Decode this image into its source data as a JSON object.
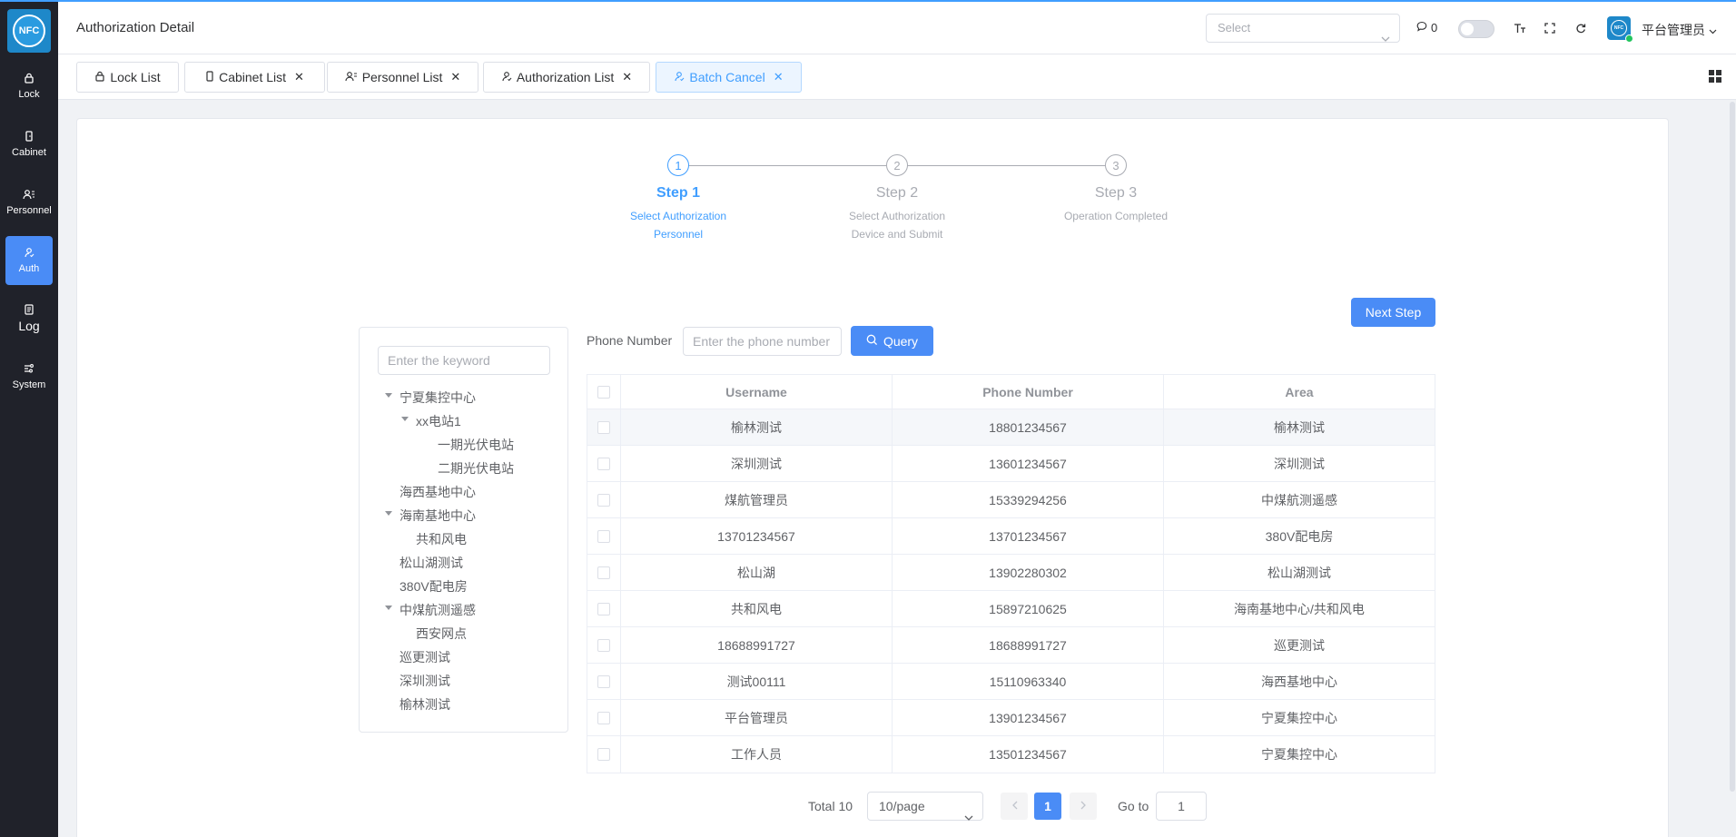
{
  "app": {
    "logo_text": "NFC"
  },
  "sidebar": {
    "items": [
      {
        "label": "Lock",
        "icon": "lock-icon"
      },
      {
        "label": "Cabinet",
        "icon": "cabinet-icon"
      },
      {
        "label": "Personnel",
        "icon": "personnel-icon"
      },
      {
        "label": "Auth",
        "icon": "auth-icon",
        "active": true
      },
      {
        "label": "Log",
        "icon": "log-icon"
      },
      {
        "label": "System",
        "icon": "system-icon"
      }
    ]
  },
  "header": {
    "title": "Authorization Detail",
    "select_placeholder": "Select",
    "message_count": "0",
    "avatar_text": "NFC",
    "user_name": "平台管理员"
  },
  "tabs": [
    {
      "label": "Lock List",
      "closable": false
    },
    {
      "label": "Cabinet List",
      "closable": true
    },
    {
      "label": "Personnel List",
      "closable": true
    },
    {
      "label": "Authorization List",
      "closable": true
    },
    {
      "label": "Batch Cancel",
      "closable": true,
      "active": true
    }
  ],
  "steps": [
    {
      "number": "1",
      "title": "Step 1",
      "desc_line1": "Select Authorization",
      "desc_line2": "Personnel",
      "active": true
    },
    {
      "number": "2",
      "title": "Step 2",
      "desc_line1": "Select Authorization",
      "desc_line2": "Device and Submit",
      "active": false
    },
    {
      "number": "3",
      "title": "Step 3",
      "desc_line1": "Operation Completed",
      "desc_line2": "",
      "active": false
    }
  ],
  "next_step_label": "Next Step",
  "tree": {
    "search_placeholder": "Enter the keyword",
    "nodes": [
      {
        "label": "宁夏集控中心",
        "level": 0,
        "expanded": true
      },
      {
        "label": "xx电站1",
        "level": 1,
        "expanded": true
      },
      {
        "label": "一期光伏电站",
        "level": 2
      },
      {
        "label": "二期光伏电站",
        "level": 2
      },
      {
        "label": "海西基地中心",
        "level": 0
      },
      {
        "label": "海南基地中心",
        "level": 0,
        "expanded": true
      },
      {
        "label": "共和风电",
        "level": 1
      },
      {
        "label": "松山湖测试",
        "level": 0
      },
      {
        "label": "380V配电房",
        "level": 0
      },
      {
        "label": "中煤航测遥感",
        "level": 0,
        "expanded": true
      },
      {
        "label": "西安网点",
        "level": 1
      },
      {
        "label": "巡更测试",
        "level": 0
      },
      {
        "label": "深圳测试",
        "level": 0
      },
      {
        "label": "榆林测试",
        "level": 0
      }
    ]
  },
  "query": {
    "label": "Phone Number",
    "placeholder": "Enter the phone number",
    "button_label": "Query"
  },
  "table": {
    "headers": [
      "Username",
      "Phone Number",
      "Area"
    ],
    "rows": [
      [
        "榆林测试",
        "18801234567",
        "榆林测试"
      ],
      [
        "深圳测试",
        "13601234567",
        "深圳测试"
      ],
      [
        "煤航管理员",
        "15339294256",
        "中煤航测遥感"
      ],
      [
        "13701234567",
        "13701234567",
        "380V配电房"
      ],
      [
        "松山湖",
        "13902280302",
        "松山湖测试"
      ],
      [
        "共和风电",
        "15897210625",
        "海南基地中心/共和风电"
      ],
      [
        "18688991727",
        "18688991727",
        "巡更测试"
      ],
      [
        "测试00111",
        "15110963340",
        "海西基地中心"
      ],
      [
        "平台管理员",
        "13901234567",
        "宁夏集控中心"
      ],
      [
        "工作人员",
        "13501234567",
        "宁夏集控中心"
      ]
    ]
  },
  "pagination": {
    "total_text": "Total 10",
    "page_size": "10/page",
    "current_page": "1",
    "goto_label": "Go to",
    "goto_value": "1"
  },
  "colors": {
    "primary": "#409eff",
    "sidebar_bg": "#20222a",
    "active_nav": "#4a8cf6"
  }
}
